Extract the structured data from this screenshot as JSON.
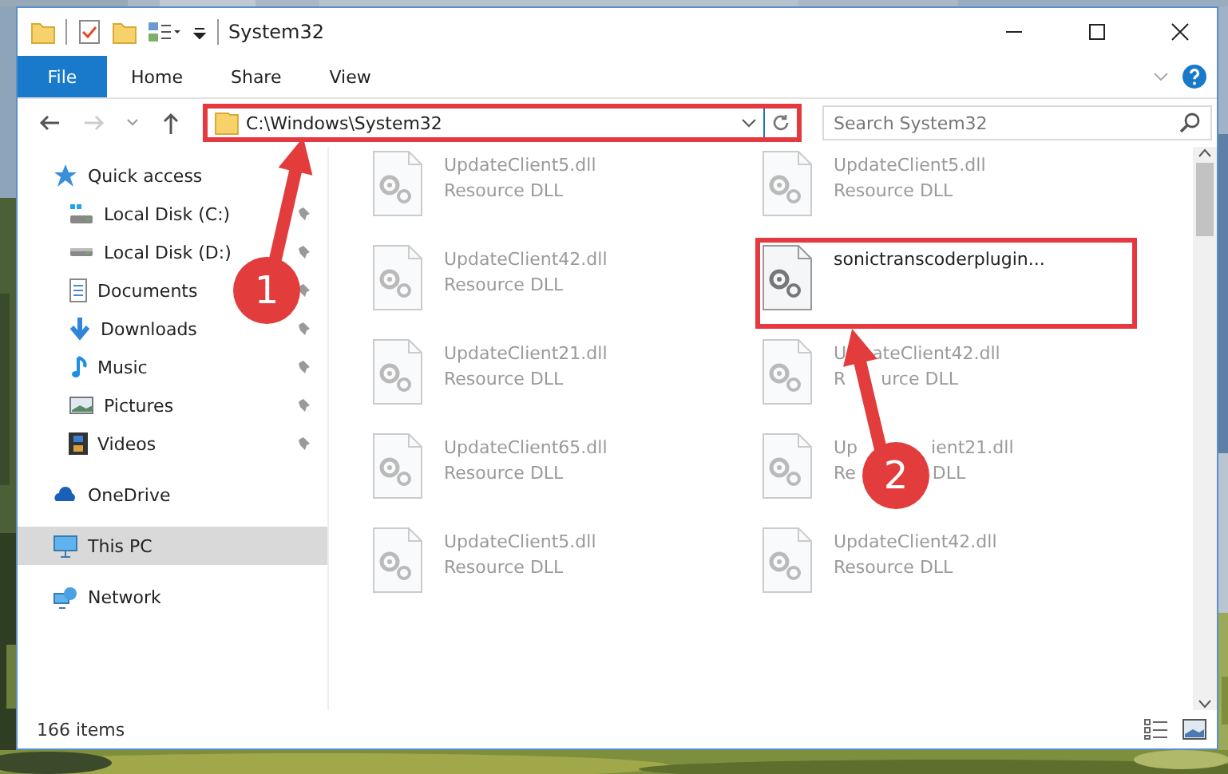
{
  "window": {
    "title": "System32"
  },
  "file_tab": {
    "label": "File"
  },
  "ribbon_tabs": [
    {
      "label": "Home"
    },
    {
      "label": "Share"
    },
    {
      "label": "View"
    }
  ],
  "address_bar": {
    "path": "C:\\Windows\\System32",
    "marker": "1"
  },
  "search": {
    "placeholder": "Search System32"
  },
  "navigation": [
    {
      "label": "Quick access",
      "kind": "star",
      "selected": false,
      "children": [
        {
          "label": "Local Disk (C:)",
          "kind": "drive-c",
          "pinned": true,
          "selected": false
        },
        {
          "label": "Local Disk (D:)",
          "kind": "drive",
          "pinned": true,
          "selected": false
        },
        {
          "label": "Documents",
          "kind": "document",
          "pinned": true,
          "selected": false
        },
        {
          "label": "Downloads",
          "kind": "download",
          "pinned": true,
          "selected": false
        },
        {
          "label": "Music",
          "kind": "music",
          "pinned": true,
          "selected": false
        },
        {
          "label": "Pictures",
          "kind": "pictures",
          "pinned": true,
          "selected": false
        },
        {
          "label": "Videos",
          "kind": "videos",
          "pinned": true,
          "selected": false
        }
      ]
    },
    {
      "label": "OneDrive",
      "kind": "cloud",
      "selected": false
    },
    {
      "label": "This PC",
      "kind": "pc",
      "selected": true
    },
    {
      "label": "Network",
      "kind": "network",
      "selected": false
    }
  ],
  "file_rows": [
    {
      "files": [
        {
          "name": "UpdateClient5.dll",
          "type": "Resource DLL",
          "dimmed": true
        },
        {
          "name": "UpdateClient5.dll",
          "type": "Resource DLL",
          "dimmed": true
        }
      ]
    },
    {
      "files": [
        {
          "name": "UpdateClient42.dll",
          "type": "Resource DLL",
          "dimmed": true
        },
        {
          "name": "sonictranscoderplugin...",
          "dimmed": false,
          "marker": "2"
        }
      ]
    },
    {
      "files": [
        {
          "name": "UpdateClient21.dll",
          "type": "Resource DLL",
          "dimmed": true
        },
        {
          "name": [
            "U",
            "ateClient42.dll"
          ],
          "type": [
            "R",
            "urce DLL"
          ],
          "dimmed": true
        }
      ]
    },
    {
      "files": [
        {
          "name": "UpdateClient65.dll",
          "type": "Resource DLL",
          "dimmed": true
        },
        {
          "name": [
            "Up",
            "ient21.dll"
          ],
          "type": [
            "Re",
            "DLL"
          ],
          "dimmed": true
        }
      ]
    },
    {
      "files": [
        {
          "name": "UpdateClient5.dll",
          "type": "Resource DLL",
          "dimmed": true
        },
        {
          "name": "UpdateClient42.dll",
          "type": "Resource DLL",
          "dimmed": true
        }
      ]
    }
  ],
  "status_bar": {
    "item_count": "166 items"
  }
}
